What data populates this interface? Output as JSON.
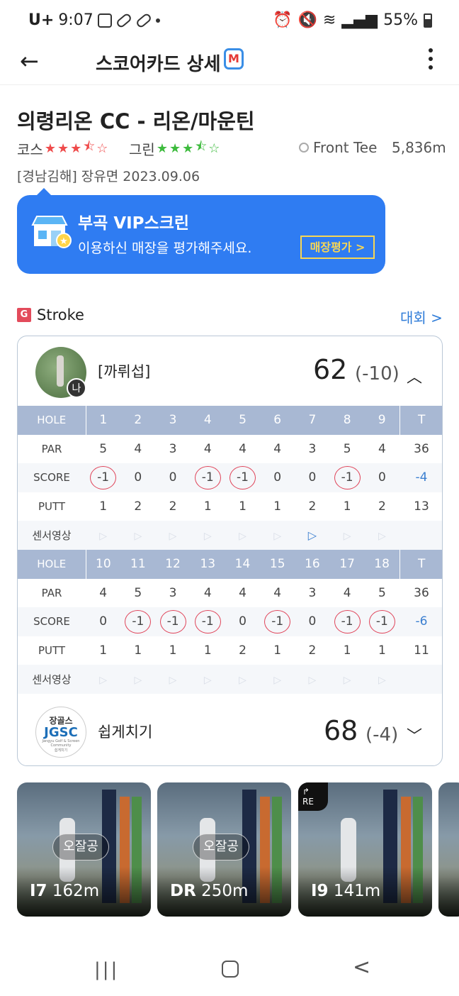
{
  "status": {
    "carrier": "U+",
    "time": "9:07",
    "battery": "55%"
  },
  "header": {
    "title": "스코어카드 상세",
    "badge": "M"
  },
  "course": {
    "name": "의령리온 CC - 리온/마운틴",
    "course_label": "코스",
    "course_rating": 3.5,
    "green_label": "그린",
    "green_rating": 3.5,
    "tee": "Front Tee",
    "distance": "5,836m",
    "region_date": "[경남김해] 장유면 2023.09.06"
  },
  "banner": {
    "title": "부곡 VIP스크린",
    "subtitle": "이용하신 매장을 평가해주세요.",
    "button": "매장평가 >"
  },
  "mode": {
    "badge": "G",
    "label": "Stroke",
    "link": "대회 >"
  },
  "player1": {
    "avatar_badge": "나",
    "name": "[까뤼섭]",
    "score": "62",
    "to_par": "(-10)"
  },
  "scorecard": {
    "labels": {
      "hole": "HOLE",
      "par": "PAR",
      "score": "SCORE",
      "putt": "PUTT",
      "video": "센서영상",
      "total": "T"
    },
    "front": {
      "holes": [
        "1",
        "2",
        "3",
        "4",
        "5",
        "6",
        "7",
        "8",
        "9"
      ],
      "par": [
        "5",
        "4",
        "3",
        "4",
        "4",
        "4",
        "3",
        "5",
        "4"
      ],
      "par_total": "36",
      "score": [
        "-1",
        "0",
        "0",
        "-1",
        "-1",
        "0",
        "0",
        "-1",
        "0"
      ],
      "score_total": "-4",
      "putt": [
        "1",
        "2",
        "2",
        "1",
        "1",
        "1",
        "2",
        "1",
        "2"
      ],
      "putt_total": "13",
      "video_active": [
        false,
        false,
        false,
        false,
        false,
        false,
        true,
        false,
        false
      ]
    },
    "back": {
      "holes": [
        "10",
        "11",
        "12",
        "13",
        "14",
        "15",
        "16",
        "17",
        "18"
      ],
      "par": [
        "4",
        "5",
        "3",
        "4",
        "4",
        "4",
        "3",
        "4",
        "5"
      ],
      "par_total": "36",
      "score": [
        "0",
        "-1",
        "-1",
        "-1",
        "0",
        "-1",
        "0",
        "-1",
        "-1"
      ],
      "score_total": "-6",
      "putt": [
        "1",
        "1",
        "1",
        "1",
        "2",
        "1",
        "2",
        "1",
        "1"
      ],
      "putt_total": "11",
      "video_active": [
        false,
        false,
        false,
        false,
        false,
        false,
        false,
        false,
        false
      ]
    }
  },
  "player2": {
    "logo_top": "장골스",
    "logo_main": "JGSC",
    "logo_sub": "Jangyu Golf & Screen Community",
    "logo_bottom": "쉽게치기",
    "name": "쉽게치기",
    "score": "68",
    "to_par": "(-4)"
  },
  "shots": [
    {
      "tag": "오잘공",
      "club": "I7",
      "dist": "162m",
      "replay": ""
    },
    {
      "tag": "오잘공",
      "club": "DR",
      "dist": "250m",
      "replay": ""
    },
    {
      "tag": "",
      "club": "I9",
      "dist": "141m",
      "replay": "RE"
    }
  ],
  "nav": {
    "recent": "|||",
    "back": "<"
  }
}
